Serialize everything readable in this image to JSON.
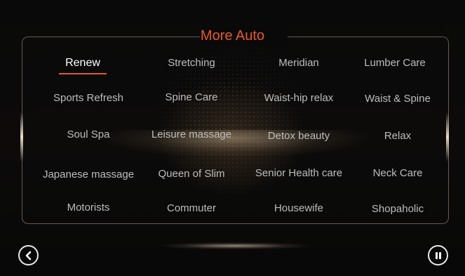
{
  "title": "More Auto",
  "active_index": 0,
  "colors": {
    "accent": "#e85a1e",
    "text_inactive": "#bdbdbd",
    "text_active": "#ffffff",
    "panel_border": "#6b5a4d"
  },
  "programs": [
    [
      "Renew",
      "Stretching",
      "Meridian",
      "Lumber Care"
    ],
    [
      "Sports Refresh",
      "Spine Care",
      "Waist-hip relax",
      "Waist & Spine"
    ],
    [
      "Soul Spa",
      "Leisure massage",
      "Detox beauty",
      "Relax"
    ],
    [
      "Japanese massage",
      "Queen of Slim",
      "Senior Health care",
      "Neck Care"
    ],
    [
      "Motorists",
      "Commuter",
      "Housewife",
      "Shopaholic"
    ]
  ],
  "icons": {
    "back": "chevron-left-icon",
    "pause": "pause-icon"
  }
}
